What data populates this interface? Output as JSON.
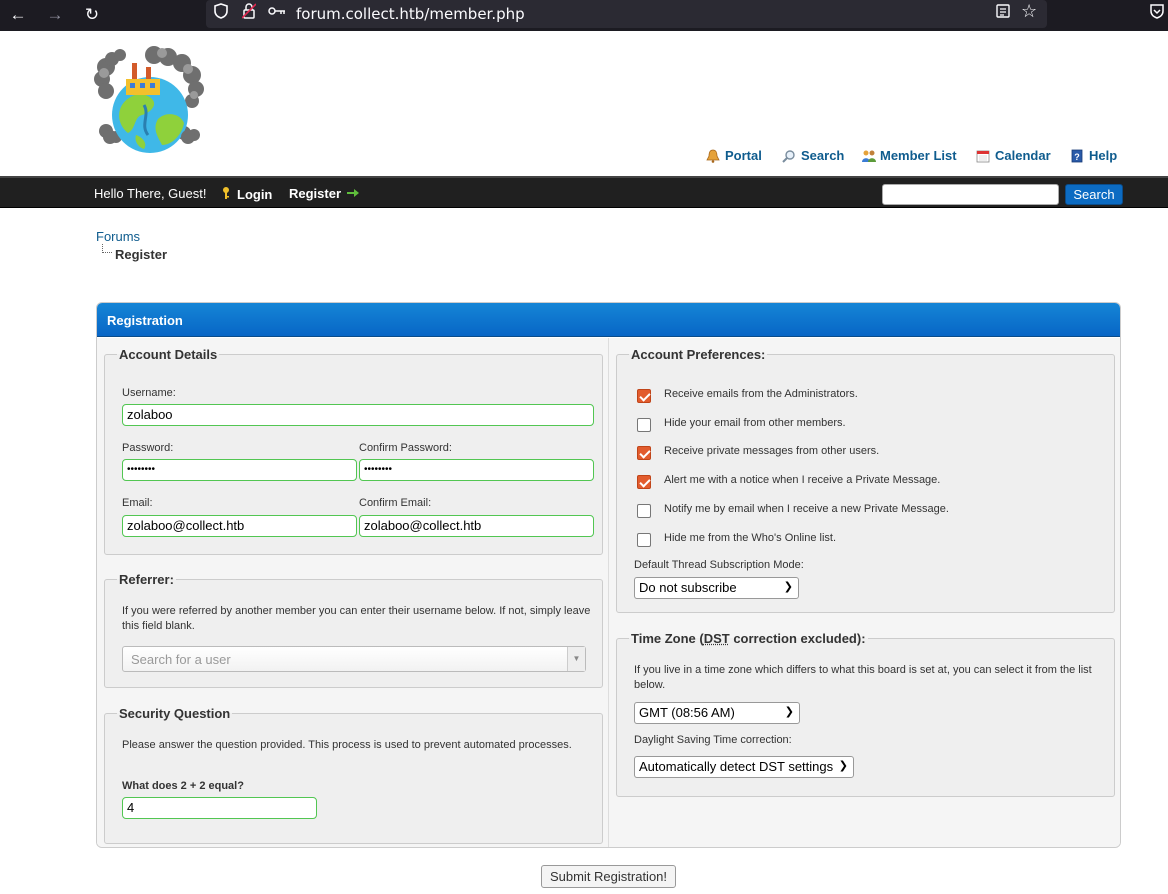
{
  "browser": {
    "url": "forum.collect.htb/member.php"
  },
  "header": {
    "links": [
      {
        "label": "Portal",
        "icon": "bell-icon"
      },
      {
        "label": "Search",
        "icon": "magnifier-icon"
      },
      {
        "label": "Member List",
        "icon": "members-icon"
      },
      {
        "label": "Calendar",
        "icon": "calendar-icon"
      },
      {
        "label": "Help",
        "icon": "help-book-icon"
      }
    ]
  },
  "toolbar": {
    "welcome": "Hello There, Guest!",
    "login": "Login",
    "register": "Register",
    "search_button": "Search",
    "search_value": ""
  },
  "breadcrumb": {
    "parent": "Forums",
    "current": "Register"
  },
  "registration": {
    "title": "Registration",
    "account_details": {
      "legend": "Account Details",
      "username_label": "Username:",
      "username_value": "zolaboo",
      "password_label": "Password:",
      "password_value": "••••••••",
      "confirm_password_label": "Confirm Password:",
      "confirm_password_value": "••••••••",
      "email_label": "Email:",
      "email_value": "zolaboo@collect.htb",
      "confirm_email_label": "Confirm Email:",
      "confirm_email_value": "zolaboo@collect.htb"
    },
    "referrer": {
      "legend": "Referrer:",
      "help": "If you were referred by another member you can enter their username below. If not, simply leave this field blank.",
      "placeholder": "Search for a user"
    },
    "security": {
      "legend": "Security Question",
      "help": "Please answer the question provided. This process is used to prevent automated processes.",
      "question": "What does 2 + 2 equal?",
      "answer": "4"
    },
    "preferences": {
      "legend": "Account Preferences:",
      "options": [
        {
          "label": "Receive emails from the Administrators.",
          "checked": true
        },
        {
          "label": "Hide your email from other members.",
          "checked": false
        },
        {
          "label": "Receive private messages from other users.",
          "checked": true
        },
        {
          "label": "Alert me with a notice when I receive a Private Message.",
          "checked": true
        },
        {
          "label": "Notify me by email when I receive a new Private Message.",
          "checked": false
        },
        {
          "label": "Hide me from the Who's Online list.",
          "checked": false
        }
      ],
      "subscription_label": "Default Thread Subscription Mode:",
      "subscription_value": "Do not subscribe"
    },
    "timezone": {
      "legend_pre": "Time Zone (",
      "legend_dst": "DST",
      "legend_post": " correction excluded):",
      "help": "If you live in a time zone which differs to what this board is set at, you can select it from the list below.",
      "timezone_value": "GMT (08:56 AM)",
      "dst_label": "Daylight Saving Time correction:",
      "dst_value": "Automatically detect DST settings"
    },
    "submit": "Submit Registration!"
  },
  "colors": {
    "accent": "#0866c6",
    "checkbox_checked": "#e25c2e",
    "valid_border": "#52c652",
    "link": "#0f5c8e"
  }
}
